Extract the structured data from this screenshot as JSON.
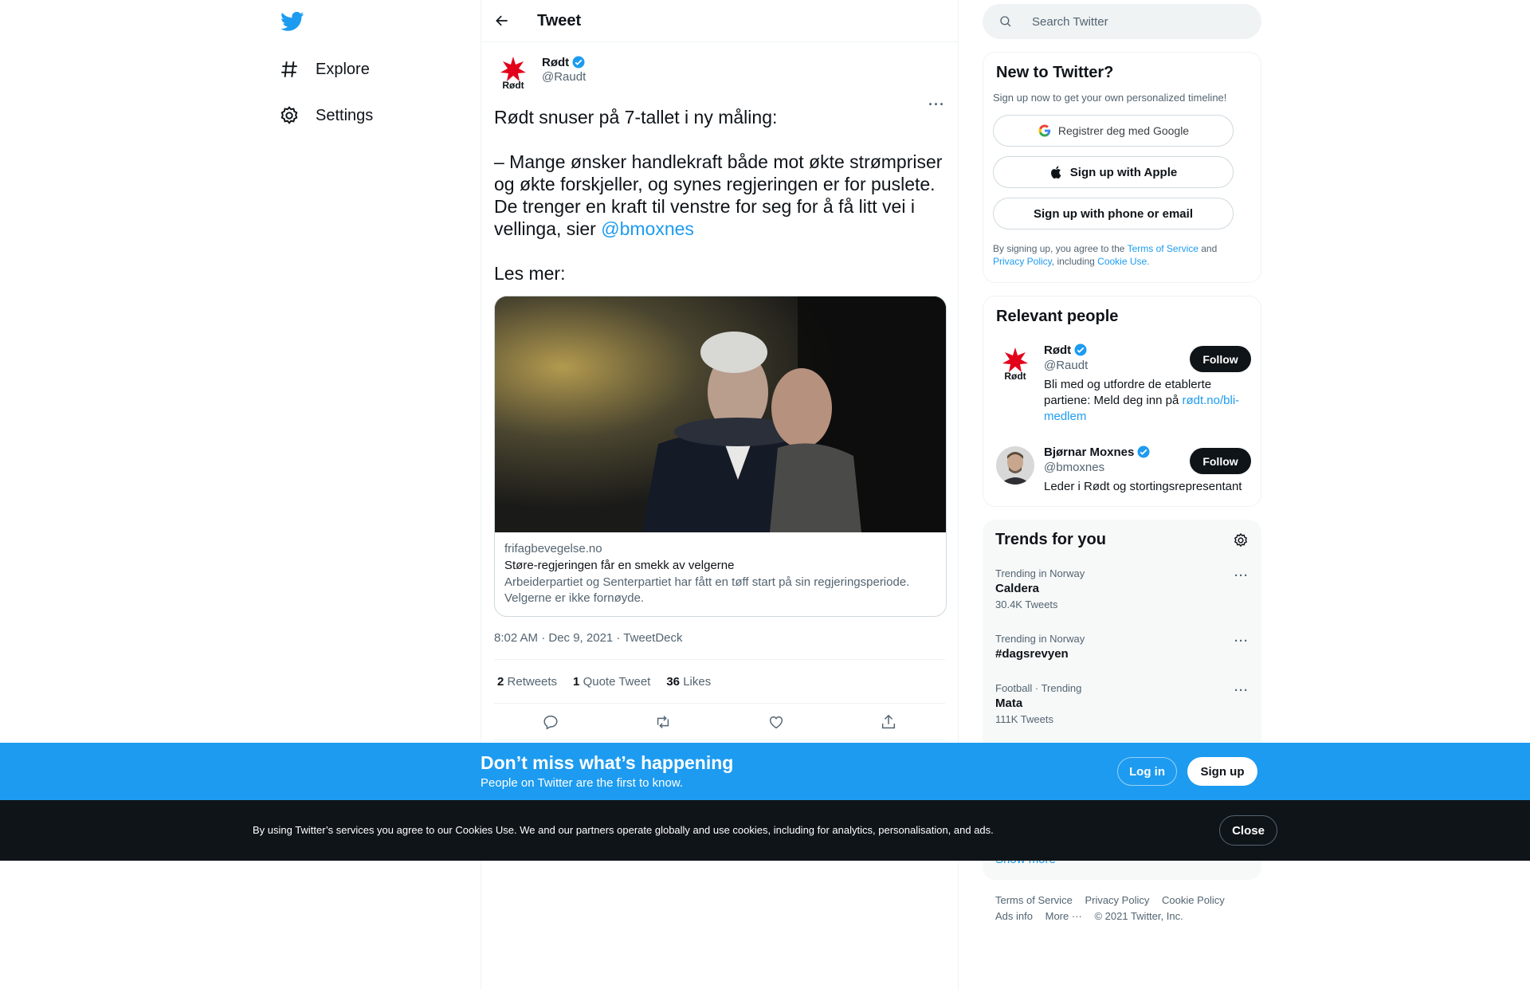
{
  "nav": {
    "logo": "twitter-bird-icon",
    "items": [
      {
        "label": "Explore",
        "icon": "hashtag-icon"
      },
      {
        "label": "Settings",
        "icon": "gear-icon"
      }
    ]
  },
  "header": {
    "title": "Tweet"
  },
  "tweet": {
    "author_name": "Rødt",
    "author_handle": "@Raudt",
    "avatar_text": "Rødt",
    "text_main": "Rødt snuser på 7-tallet i ny måling:\n\n– Mange ønsker handlekraft både mot økte strømpriser og økte forskjeller, og synes regjeringen er for puslete. De trenger en kraft til venstre for seg for å få litt vei i vellinga, sier ",
    "mention": "@bmoxnes",
    "text_end": "Les mer:",
    "card": {
      "domain": "frifagbevegelse.no",
      "title": "Støre-regjeringen får en smekk av velgerne",
      "description": "Arbeiderpartiet og Senterpartiet har fått en tøff start på sin regjeringsperiode. Velgerne er ikke fornøyde."
    },
    "meta": "8:02 AM · Dec 9, 2021 · TweetDeck",
    "stats": {
      "retweets_count": "2",
      "retweets_label": "Retweets",
      "quotes_count": "1",
      "quotes_label": "Quote Tweet",
      "likes_count": "36",
      "likes_label": "Likes"
    }
  },
  "search": {
    "placeholder": "Search Twitter"
  },
  "new_to_twitter": {
    "title": "New to Twitter?",
    "subtitle": "Sign up now to get your own personalized timeline!",
    "google_btn": "Registrer deg med Google",
    "apple_btn": "Sign up with Apple",
    "phone_btn": "Sign up with phone or email",
    "legal_1": "By signing up, you agree to the ",
    "legal_tos": "Terms of Service",
    "legal_2": " and ",
    "legal_privacy": "Privacy Policy",
    "legal_3": ", including ",
    "legal_cookie": "Cookie Use."
  },
  "relevant_people": {
    "title": "Relevant people",
    "people": [
      {
        "name": "Rødt",
        "handle": "@Raudt",
        "bio": "Bli med og utfordre de etablerte partiene: Meld deg inn på ",
        "bio_link": "rødt.no/bli-medlem",
        "follow": "Follow"
      },
      {
        "name": "Bjørnar Moxnes",
        "handle": "@bmoxnes",
        "bio": "Leder i Rødt og stortingsrepresentant",
        "follow": "Follow"
      }
    ]
  },
  "trends": {
    "title": "Trends for you",
    "items": [
      {
        "meta": "Trending in Norway",
        "name": "Caldera",
        "count": "30.4K Tweets"
      },
      {
        "meta": "Trending in Norway",
        "name": "#dagsrevyen",
        "count": ""
      },
      {
        "meta": "Football · Trending",
        "name": "Mata",
        "count": "111K Tweets"
      }
    ],
    "show_more": "Show more"
  },
  "footer": {
    "terms": "Terms of Service",
    "privacy": "Privacy Policy",
    "cookie": "Cookie Policy",
    "ads": "Ads info",
    "more": "More ···",
    "copyright": "© 2021 Twitter, Inc."
  },
  "login_bar": {
    "title": "Don’t miss what’s happening",
    "subtitle": "People on Twitter are the first to know.",
    "login": "Log in",
    "signup": "Sign up"
  },
  "cookie_bar": {
    "text": "By using Twitter’s services you agree to our Cookies Use. We and our partners operate globally and use cookies, including for analytics, personalisation, and ads.",
    "close": "Close"
  },
  "colors": {
    "accent": "#1d9bf0",
    "red": "#e2001a",
    "dark": "#0f1419"
  }
}
